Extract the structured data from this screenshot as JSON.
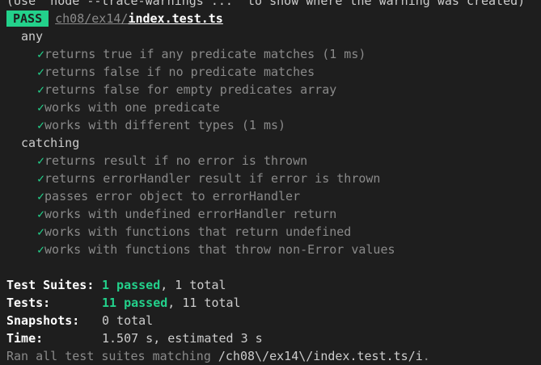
{
  "warning_line": "(Use `node --trace-warnings ...` to show where the warning was created)",
  "result": {
    "badge": "PASS",
    "file_dir": "ch08/ex14/",
    "file_name": "index.test.ts"
  },
  "check_glyph": "✓",
  "groups": [
    {
      "name": "any",
      "tests": [
        "returns true if any predicate matches (1 ms)",
        "returns false if no predicate matches",
        "returns false for empty predicates array",
        "works with one predicate",
        "works with different types (1 ms)"
      ]
    },
    {
      "name": "catching",
      "tests": [
        "returns result if no error is thrown",
        "returns errorHandler result if error is thrown",
        "passes error object to errorHandler",
        "works with undefined errorHandler return",
        "works with functions that return undefined",
        "works with functions that throw non-Error values"
      ]
    }
  ],
  "summary": {
    "suites": {
      "label": "Test Suites:",
      "passed": "1 passed",
      "rest": ", 1 total"
    },
    "tests": {
      "label": "Tests:",
      "passed": "11 passed",
      "rest": ", 11 total"
    },
    "snapshots": {
      "label": "Snapshots:",
      "value": "0 total"
    },
    "time": {
      "label": "Time:",
      "value": "1.507 s, estimated 3 s"
    }
  },
  "ran": {
    "prefix": "Ran all test suites matching ",
    "pattern": "/ch08\\/ex14\\/index.test.ts/i",
    "suffix": "."
  },
  "colors": {
    "background": "#1e1e1e",
    "pass": "#23d18b",
    "dim": "#8a8a8a",
    "text": "#cccccc",
    "bright": "#ffffff"
  }
}
